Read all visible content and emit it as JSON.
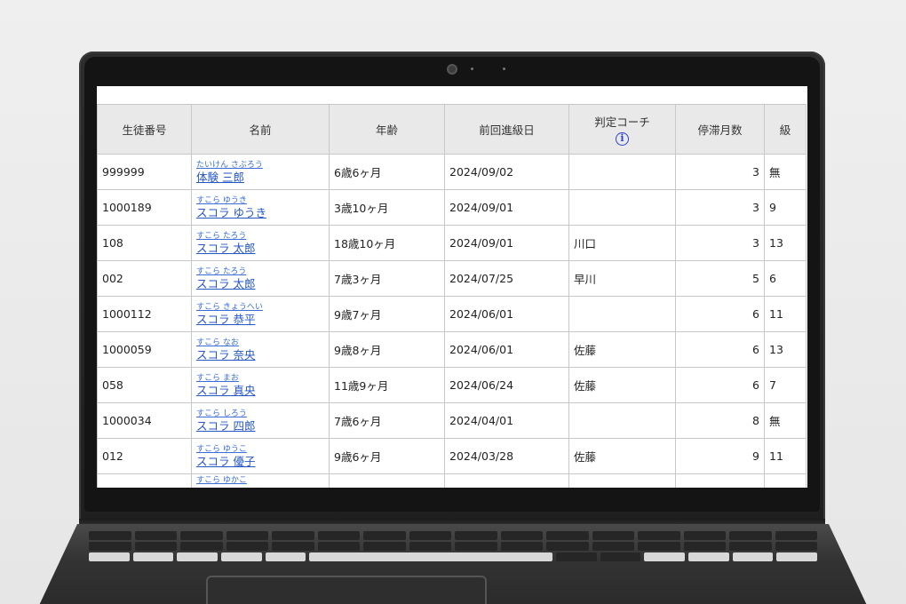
{
  "table": {
    "headers": {
      "student_no": "生徒番号",
      "name": "名前",
      "age": "年齢",
      "last_promotion": "前回進級日",
      "judge_coach": "判定コーチ",
      "stagnant_months": "停滞月数",
      "grade": "級"
    },
    "info_icon": "i",
    "rows": [
      {
        "no": "999999",
        "kana": "たいけん さぶろう",
        "name": "体験 三郎",
        "age": "6歳6ヶ月",
        "date": "2024/09/02",
        "coach": "",
        "months": "3",
        "grade": "無"
      },
      {
        "no": "1000189",
        "kana": "すこら ゆうき",
        "name": "スコラ ゆうき",
        "age": "3歳10ヶ月",
        "date": "2024/09/01",
        "coach": "",
        "months": "3",
        "grade": "9"
      },
      {
        "no": "108",
        "kana": "すこら たろう",
        "name": "スコラ 太郎",
        "age": "18歳10ヶ月",
        "date": "2024/09/01",
        "coach": "川口",
        "months": "3",
        "grade": "13"
      },
      {
        "no": "002",
        "kana": "すこら たろう",
        "name": "スコラ 太郎",
        "age": "7歳3ヶ月",
        "date": "2024/07/25",
        "coach": "早川",
        "months": "5",
        "grade": "6"
      },
      {
        "no": "1000112",
        "kana": "すこら きょうへい",
        "name": "スコラ 恭平",
        "age": "9歳7ヶ月",
        "date": "2024/06/01",
        "coach": "",
        "months": "6",
        "grade": "11"
      },
      {
        "no": "1000059",
        "kana": "すこら なお",
        "name": "スコラ 奈央",
        "age": "9歳8ヶ月",
        "date": "2024/06/01",
        "coach": "佐藤",
        "months": "6",
        "grade": "13"
      },
      {
        "no": "058",
        "kana": "すこら まお",
        "name": "スコラ 真央",
        "age": "11歳9ヶ月",
        "date": "2024/06/24",
        "coach": "佐藤",
        "months": "6",
        "grade": "7"
      },
      {
        "no": "1000034",
        "kana": "すこら しろう",
        "name": "スコラ 四郎",
        "age": "7歳6ヶ月",
        "date": "2024/04/01",
        "coach": "",
        "months": "8",
        "grade": "無"
      },
      {
        "no": "012",
        "kana": "すこら ゆうこ",
        "name": "スコラ 優子",
        "age": "9歳6ヶ月",
        "date": "2024/03/28",
        "coach": "佐藤",
        "months": "9",
        "grade": "11"
      }
    ],
    "partial_row": {
      "kana": "すこら ゆかこ"
    }
  }
}
